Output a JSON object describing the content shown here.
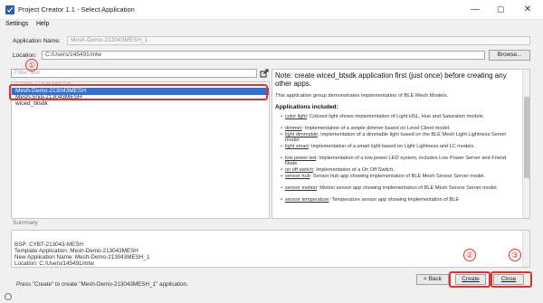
{
  "window": {
    "title": "Project Creator 1.1 - Select Application",
    "minimize": "—",
    "maximize": "☐",
    "close": "✕"
  },
  "menu": [
    "Settings",
    "Help"
  ],
  "application_name": {
    "label": "Application Name:",
    "value": "Mesh-Demo-213043MESH_1"
  },
  "location": {
    "label": "Location:",
    "value": "C:/Users/145491/mtw",
    "browse_label": "Browse..."
  },
  "filter": {
    "placeholder": "Filter Text"
  },
  "app_list": {
    "items": [
      "Empty-213043MESH",
      "Mesh-Demo-213043MESH",
      "Mesh-Snip-213043MESH",
      "wiced_btsdk"
    ],
    "selected": "Mesh-Demo-213043MESH"
  },
  "description": {
    "heading": "Note: create wiced_btsdk application first (just once) before creating any other apps.",
    "intro": "This application group demonstrates implementation of BLE Mesh Models.",
    "subheading": "Applications included:",
    "bullets": [
      {
        "name": "color light",
        "text": ": Colored light shows implementation of Light HSL, Hue and Saturation models."
      },
      {
        "name": "dimmer",
        "text": ": Implementation of a simple dimmer based on Level Client model."
      },
      {
        "name": "light dimmable",
        "text": ": Implementation of a dimmable light based on the BLE Mesh Light Lightness Server model."
      },
      {
        "name": "light smart",
        "text": ": Implementation of a smart light based on Light Lightness and LC models."
      },
      {
        "name": "low power led",
        "text": ": Implementation of a low power LED system, includes Low Power Server and Friend Node."
      },
      {
        "name": "on off switch",
        "text": ": Implementation of a On Off Switch."
      },
      {
        "name": "sensor hub",
        "text": ": Sensor hub app showing implementation of BLE Mesh Sensor Server model."
      },
      {
        "name": "sensor motion",
        "text": ": Motion sensor app showing implementation of BLE Mesh Sensor Server model."
      },
      {
        "name": "sensor temperature",
        "text": ": Temperature sensor app showing implementation of BLE"
      }
    ]
  },
  "summary": {
    "label": "Summary",
    "lines": [
      "BSP: CYBT-213043-MESH",
      "Template Application: Mesh-Demo-213043MESH",
      "New Application Name: Mesh-Demo-213043MESH_1",
      "Location: C:/Users/145491/mtw",
      "",
      "Press \"Create\" to create \"Mesh-Demo-213043MESH_1\" application."
    ]
  },
  "buttons": {
    "back": "< Back",
    "create": "Create",
    "close": "Close"
  },
  "annotations": {
    "one": "①",
    "two": "②",
    "three": "③",
    "color": "#e0322a"
  }
}
